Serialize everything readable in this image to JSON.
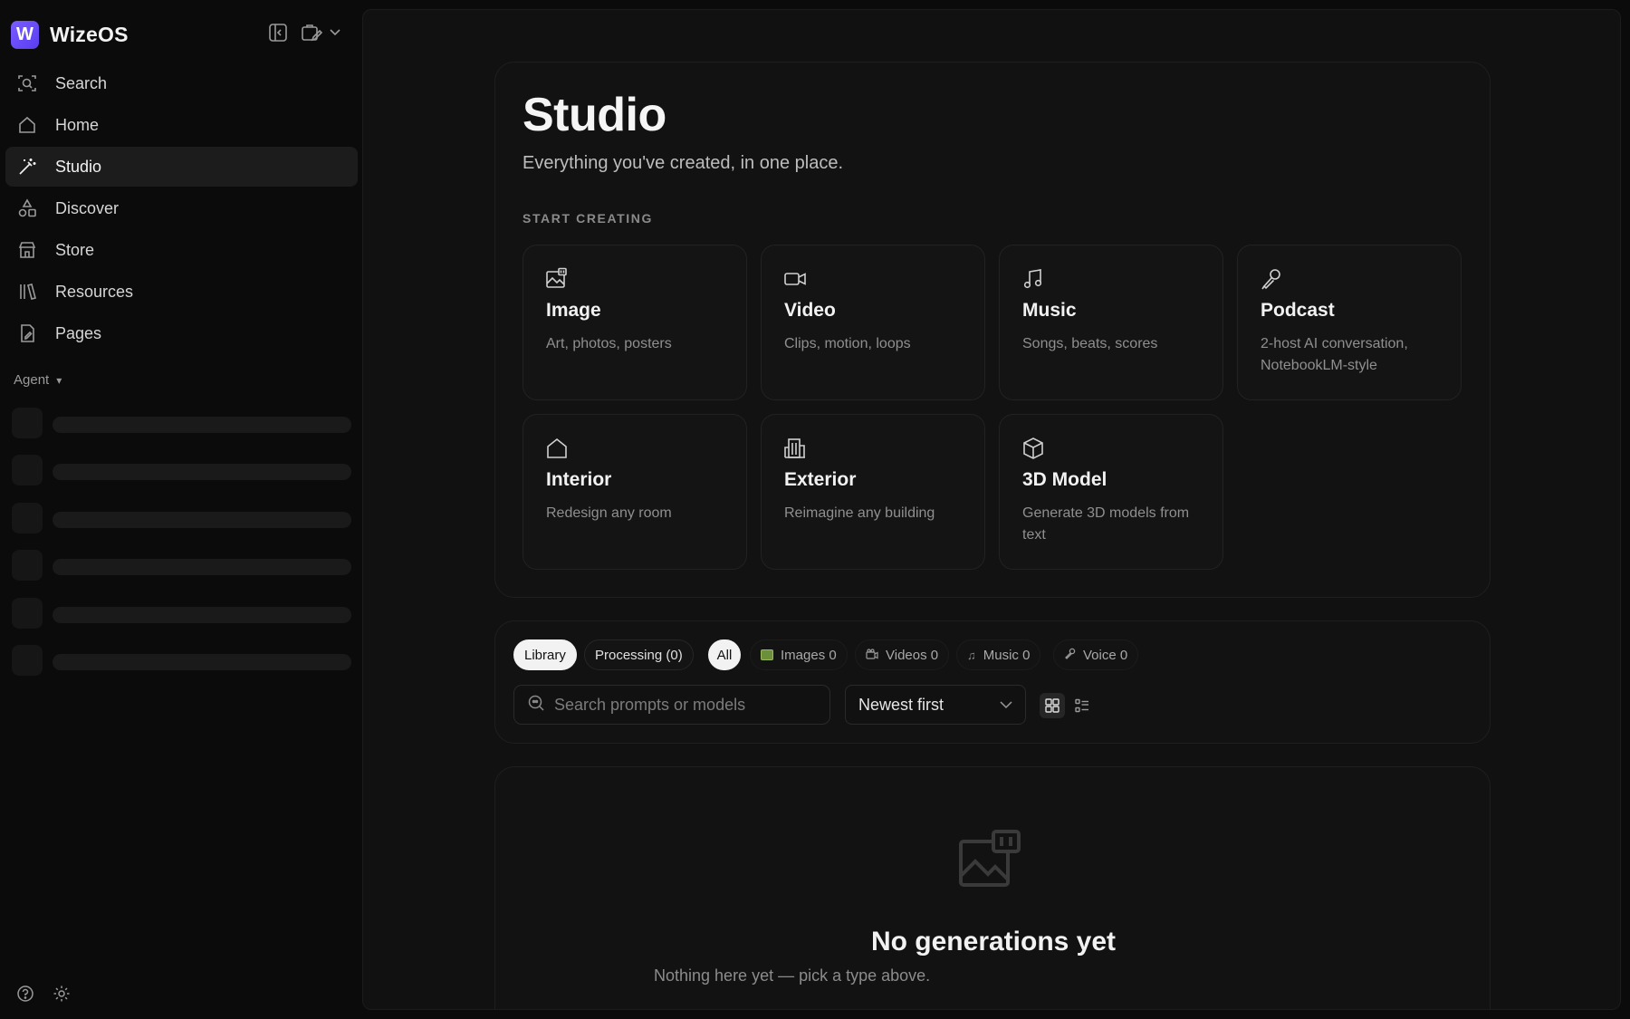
{
  "app": {
    "name": "WizeOS",
    "logo_letter": "W"
  },
  "sidebar": {
    "items": [
      {
        "label": "Search",
        "icon": "search-icon"
      },
      {
        "label": "Home",
        "icon": "home-icon"
      },
      {
        "label": "Studio",
        "icon": "magic-wand-icon",
        "active": true
      },
      {
        "label": "Discover",
        "icon": "shapes-icon"
      },
      {
        "label": "Store",
        "icon": "store-icon"
      },
      {
        "label": "Resources",
        "icon": "library-icon"
      },
      {
        "label": "Pages",
        "icon": "page-icon"
      }
    ],
    "agent_label": "Agent",
    "agent_caret": "▾"
  },
  "studio": {
    "title": "Studio",
    "subtitle": "Everything you've created, in one place.",
    "section_label": "START CREATING",
    "tiles": [
      {
        "name": "Image",
        "desc": "Art, photos, posters",
        "icon": "image-icon"
      },
      {
        "name": "Video",
        "desc": "Clips, motion, loops",
        "icon": "video-camera-icon"
      },
      {
        "name": "Music",
        "desc": "Songs, beats, scores",
        "icon": "music-note-icon"
      },
      {
        "name": "Podcast",
        "desc": "2-host AI conversation, NotebookLM-style",
        "icon": "microphone-icon"
      },
      {
        "name": "Interior",
        "desc": "Redesign any room",
        "icon": "house-icon"
      },
      {
        "name": "Exterior",
        "desc": "Reimagine any building",
        "icon": "building-icon"
      },
      {
        "name": "3D Model",
        "desc": "Generate 3D models from text",
        "icon": "cube-icon"
      }
    ]
  },
  "filters": {
    "library": "Library",
    "processing": "Processing (0)",
    "all": "All",
    "images": "Images 0",
    "videos": "Videos 0",
    "music": "Music 0",
    "voice": "Voice 0",
    "search_placeholder": "Search prompts or models",
    "sort_value": "Newest first"
  },
  "empty_state": {
    "title": "No generations yet",
    "subtitle": "Nothing here yet — pick a type above."
  }
}
